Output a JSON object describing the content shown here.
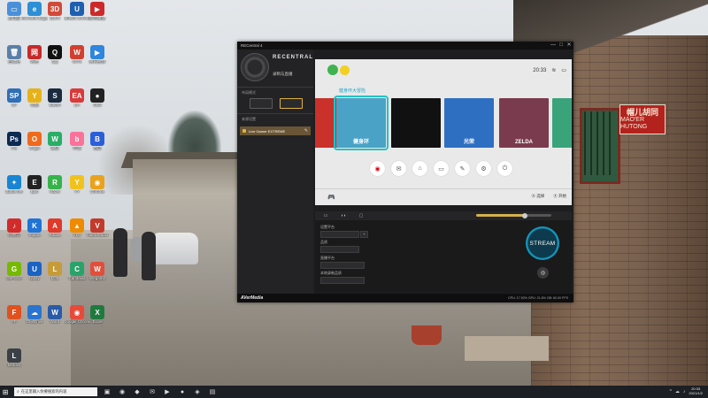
{
  "desktop": {
    "icons": [
      {
        "label": "此电脑",
        "glyph": "▭",
        "color": "#4a90d9"
      },
      {
        "label": "Microsoft Edge",
        "glyph": "e",
        "color": "#2d8fd4"
      },
      {
        "label": "3DVR",
        "glyph": "3D",
        "color": "#d24a3a"
      },
      {
        "label": "Ubisoft Connect",
        "glyph": "U",
        "color": "#1f5fb0"
      },
      {
        "label": "影音播放",
        "glyph": "▶",
        "color": "#cc2a2a"
      },
      {
        "label": "回收站",
        "glyph": "🗑",
        "color": "#5a7fa8"
      },
      {
        "label": "网易",
        "glyph": "网",
        "color": "#c62929"
      },
      {
        "label": "QQ",
        "glyph": "Q",
        "color": "#111"
      },
      {
        "label": "WPS",
        "glyph": "W",
        "color": "#d13f31"
      },
      {
        "label": "腾讯视频",
        "glyph": "▶",
        "color": "#2e86de"
      },
      {
        "label": "SP",
        "glyph": "SP",
        "color": "#2f6fb5"
      },
      {
        "label": "优酷",
        "glyph": "Y",
        "color": "#e6b21a"
      },
      {
        "label": "Steam",
        "glyph": "S",
        "color": "#1a2a3f"
      },
      {
        "label": "EA",
        "glyph": "EA",
        "color": "#d93a3a"
      },
      {
        "label": "OBS",
        "glyph": "●",
        "color": "#222"
      },
      {
        "label": "PS",
        "glyph": "Ps",
        "color": "#0a2a52"
      },
      {
        "label": "Origin",
        "glyph": "O",
        "color": "#f06a1c"
      },
      {
        "label": "微信",
        "glyph": "W",
        "color": "#2aae67"
      },
      {
        "label": "哔哩",
        "glyph": "b",
        "color": "#fb7299"
      },
      {
        "label": "百度",
        "glyph": "B",
        "color": "#2b5fd9"
      },
      {
        "label": "Battle.net",
        "glyph": "✦",
        "color": "#1785d3"
      },
      {
        "label": "Epic",
        "glyph": "E",
        "color": "#222"
      },
      {
        "label": "Razer",
        "glyph": "R",
        "color": "#37b34a"
      },
      {
        "label": "YY",
        "glyph": "Y",
        "color": "#f1c21b"
      },
      {
        "label": "Chrome",
        "glyph": "◉",
        "color": "#e9a21c"
      },
      {
        "label": "网易云",
        "glyph": "♪",
        "color": "#d12b2b"
      },
      {
        "label": "Kugou",
        "glyph": "K",
        "color": "#2074d4"
      },
      {
        "label": "Adobe",
        "glyph": "A",
        "color": "#e03a2b"
      },
      {
        "label": "VLC",
        "glyph": "▲",
        "color": "#f08a00"
      },
      {
        "label": "VideoStudio",
        "glyph": "V",
        "color": "#c23a2b"
      },
      {
        "label": "GeForce",
        "glyph": "G",
        "color": "#76b900"
      },
      {
        "label": "Uplay",
        "glyph": "U",
        "color": "#1b62c2"
      },
      {
        "label": "LOL",
        "glyph": "L",
        "color": "#c69b3a"
      },
      {
        "label": "Camtasia",
        "glyph": "C",
        "color": "#2aa36b"
      },
      {
        "label": "Wegame",
        "glyph": "W",
        "color": "#e14e3c"
      },
      {
        "label": "FF",
        "glyph": "F",
        "color": "#e0511e"
      },
      {
        "label": "OneDrive",
        "glyph": "☁",
        "color": "#2a74d0"
      },
      {
        "label": "Word",
        "glyph": "W",
        "color": "#2a5ba8"
      },
      {
        "label": "Google Chrome",
        "glyph": "◉",
        "color": "#e84a3a"
      },
      {
        "label": "Excel",
        "glyph": "X",
        "color": "#1f7a3e"
      },
      {
        "label": "Lenovo",
        "glyph": "L",
        "color": "#3b3f46"
      }
    ]
  },
  "window": {
    "title": "RECentral 4",
    "controls": [
      "—",
      "□",
      "✕"
    ],
    "brand": "RECENTRAL",
    "mode": "录制与直播",
    "section_layout": "布局模式",
    "section_sources": "来源设置",
    "source_name": "Live Gamer EXTREME",
    "footer_brand": "AVerMedia",
    "footer_stats": "CPU: 17.92%  GPU: 21.8%  GB: 60.00 FPS"
  },
  "switch": {
    "time": "20:33",
    "highlight_title": "健身环大冒险",
    "tiles": [
      {
        "label": "",
        "bg": "#c9312a"
      },
      {
        "label": "健身环",
        "bg": "#4aa2c6"
      },
      {
        "label": "",
        "bg": "#111111"
      },
      {
        "label": "光荣",
        "bg": "#2e6fc2"
      },
      {
        "label": "ZELDA",
        "bg": "#7a3b4e"
      },
      {
        "label": "",
        "bg": "#3aa37a"
      }
    ],
    "menu_icons": [
      "◉",
      "✉",
      "⌂",
      "▭",
      "✎",
      "⚙",
      "⏻"
    ],
    "hint_select": "选择",
    "hint_start": "开始"
  },
  "settings": {
    "label_1": "设置平台",
    "label_2": "品质",
    "label_3": "直播平台",
    "label_4": "串流服务器",
    "label_5": "本地录制品质",
    "add": "+",
    "stream_label": "STREAM",
    "snapshot": "◎",
    "volume_percent": 65
  },
  "taskbar": {
    "start": "⊞",
    "search_placeholder": "在这里输入你要搜索的内容",
    "search_icon": "⌕",
    "apps": [
      "▣",
      "◉",
      "◆",
      "✉",
      "▶",
      "●",
      "◈",
      "▤"
    ],
    "tray": [
      "^",
      "☁",
      "♪"
    ],
    "clock_time": "20:33",
    "clock_date": "2021/1/2"
  }
}
